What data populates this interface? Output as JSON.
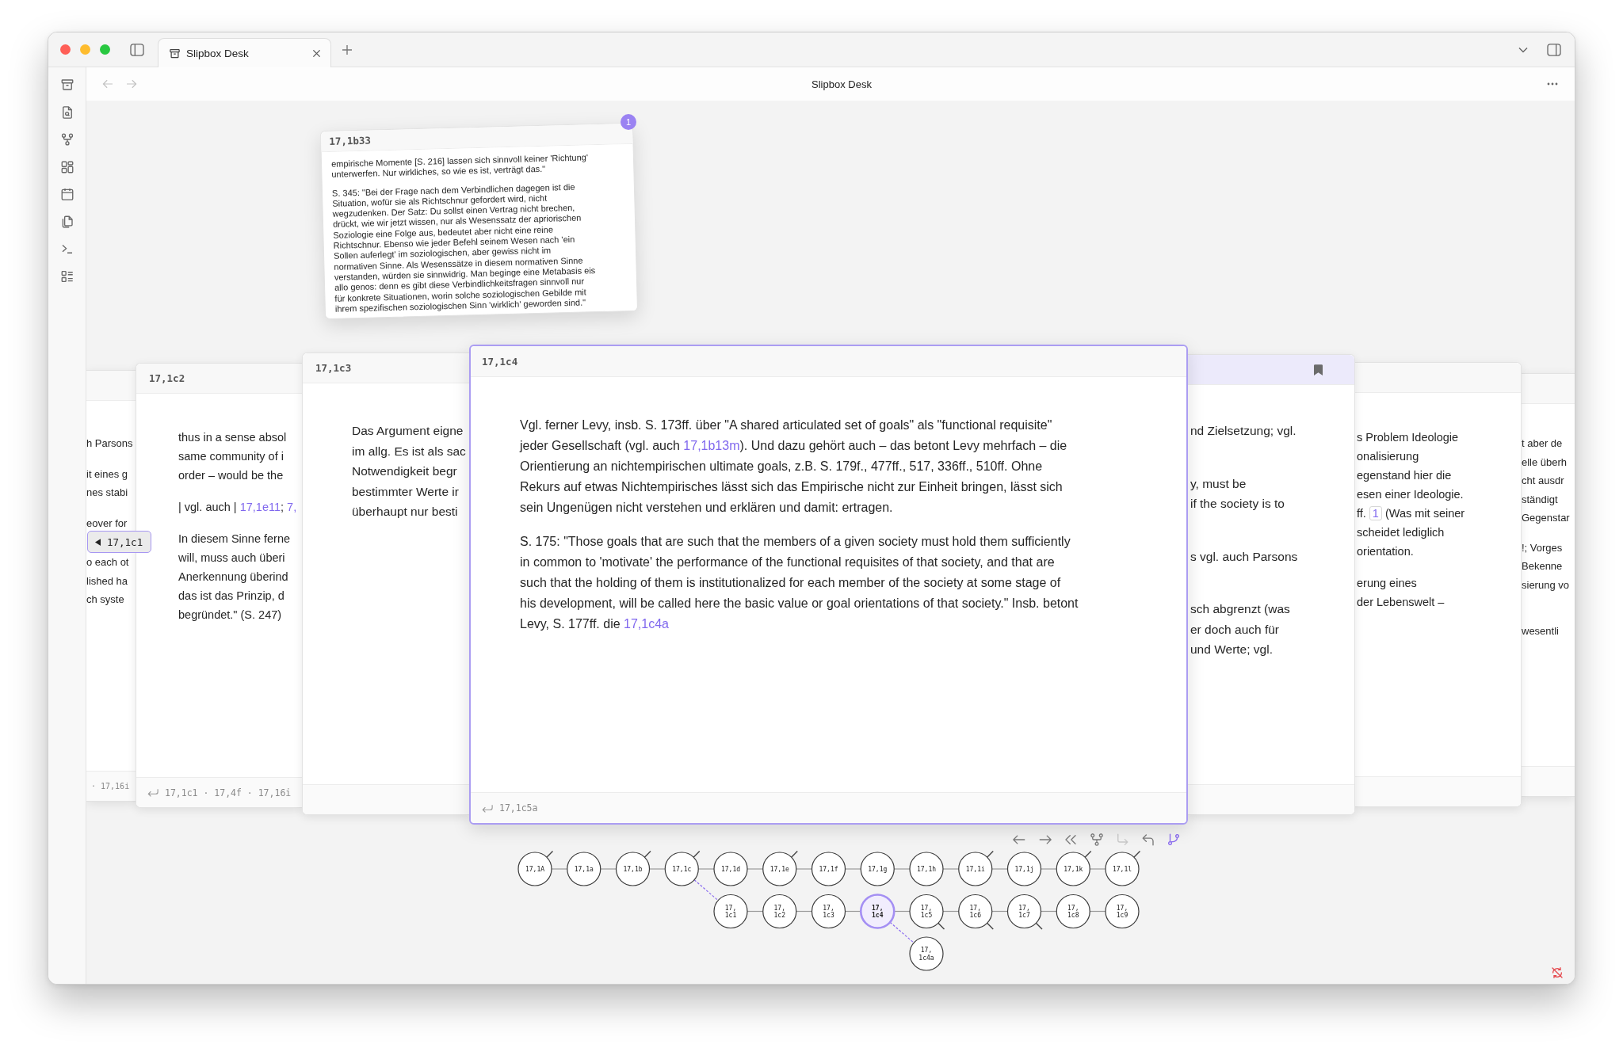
{
  "tabs": [
    {
      "title": "Slipbox Desk",
      "selected": true
    }
  ],
  "header": {
    "title": "Slipbox Desk",
    "back_disabled": true,
    "forward_disabled": true
  },
  "floating_card": {
    "id": "17,1b33",
    "badge": "1",
    "paragraphs": [
      {
        "lines": [
          [
            {
              "kind": "text",
              "text": "empirische Momente [S. 216] lassen sich sinnvoll keiner 'Richtung'"
            }
          ],
          [
            {
              "kind": "text",
              "text": "unterwerfen. Nur wirkliches, so wie es ist, verträgt das.\""
            }
          ]
        ]
      },
      {
        "lines": [
          [
            {
              "kind": "text",
              "text": "S. 345: \"Bei der Frage nach dem Verbindlichen dagegen ist die"
            }
          ],
          [
            {
              "kind": "text",
              "text": "Situation, wofür sie als Richtschnur gefordert wird, nicht"
            }
          ],
          [
            {
              "kind": "text",
              "text": "wegzudenken. Der Satz: Du sollst einen Vertrag nicht brechen,"
            }
          ],
          [
            {
              "kind": "text",
              "text": "drückt, wie wir jetzt wissen, nur als Wesenssatz der apriorischen"
            }
          ],
          [
            {
              "kind": "text",
              "text": "Soziologie eine Folge aus, bedeutet aber nicht eine reine"
            }
          ],
          [
            {
              "kind": "text",
              "text": "Richtschnur. Ebenso wie jeder Befehl seinem Wesen nach 'ein"
            }
          ],
          [
            {
              "kind": "text",
              "text": "Sollen auferlegt' im soziologischen, aber gewiss nicht im"
            }
          ],
          [
            {
              "kind": "text",
              "text": "normativen Sinne. Als Wesenssätze in diesem normativen Sinne"
            }
          ],
          [
            {
              "kind": "text",
              "text": "verstanden, würden sie sinnwidrig. Man beginge eine Metabasis eis"
            }
          ],
          [
            {
              "kind": "text",
              "text": "allo genos: denn es gibt diese Verbindlichkeitsfragen sinnvoll nur"
            }
          ],
          [
            {
              "kind": "text",
              "text": "für konkrete Situationen, worin solche soziologischen Gebilde mit"
            }
          ],
          [
            {
              "kind": "text",
              "text": "ihrem spezifischen soziologischen Sinn 'wirklich' geworden sind.\""
            }
          ]
        ]
      }
    ]
  },
  "cards": [
    {
      "bookmarked": false,
      "selected": false,
      "paragraphs": [
        {
          "lines": [
            [
              {
                "kind": "text",
                "text": "h Parsons"
              }
            ]
          ]
        },
        {
          "lines": [
            [
              {
                "kind": "text",
                "text": "it eines g"
              }
            ],
            [
              {
                "kind": "text",
                "text": "nes stabi"
              }
            ]
          ]
        },
        {
          "lines": [
            [
              {
                "kind": "text",
                "text": "eover for"
              }
            ]
          ]
        },
        {
          "lines": [
            [
              {
                "kind": "text",
                "text": "o each ot"
              }
            ],
            [
              {
                "kind": "text",
                "text": "lished ha"
              }
            ],
            [
              {
                "kind": "text",
                "text": "ch syste"
              }
            ]
          ]
        }
      ],
      "footer": "· 17,16i"
    },
    {
      "id": "17,1c2",
      "bookmarked": false,
      "selected": false,
      "paragraphs": [
        {
          "lines": [
            [
              {
                "kind": "text",
                "text": "thus in a sense absol"
              }
            ],
            [
              {
                "kind": "text",
                "text": "same community of i"
              }
            ],
            [
              {
                "kind": "text",
                "text": "order – would be the"
              }
            ]
          ]
        },
        {
          "lines": [
            [
              {
                "kind": "text",
                "text": "| vgl. auch | "
              },
              {
                "kind": "link",
                "text": "17,1e11"
              },
              {
                "kind": "text",
                "text": "; "
              },
              {
                "kind": "link",
                "text": "7,"
              }
            ]
          ]
        },
        {
          "lines": [
            [
              {
                "kind": "text",
                "text": "In diesem Sinne ferne"
              }
            ],
            [
              {
                "kind": "text",
                "text": "will, muss auch überi"
              }
            ],
            [
              {
                "kind": "text",
                "text": "Anerkennung überind"
              }
            ],
            [
              {
                "kind": "text",
                "text": "das ist das Prinzip, d"
              }
            ],
            [
              {
                "kind": "text",
                "text": "begründet.\" (S. 247)"
              }
            ]
          ]
        }
      ],
      "footer": "17,1c1 · 17,4f · 17,16i"
    },
    {
      "id": "17,1c3",
      "bookmarked": false,
      "selected": false,
      "paragraphs": [
        {
          "lines": [
            [
              {
                "kind": "text",
                "text": "Das Argument eigne"
              }
            ],
            [
              {
                "kind": "text",
                "text": "im allg. Es ist als sac"
              }
            ],
            [
              {
                "kind": "text",
                "text": "Notwendigkeit begr"
              }
            ],
            [
              {
                "kind": "text",
                "text": "bestimmter Werte ir"
              }
            ],
            [
              {
                "kind": "text",
                "text": "überhaupt nur besti"
              }
            ]
          ]
        }
      ]
    },
    {
      "id": "17,1c4",
      "bookmarked": false,
      "selected": true,
      "paragraphs": [
        {
          "lines": [
            [
              {
                "kind": "text",
                "text": "Vgl. ferner Levy, insb. S. 173ff. über \"A shared articulated set of goals\" als \"functional requisite\""
              }
            ],
            [
              {
                "kind": "text",
                "text": "jeder Gesellschaft (vgl. auch "
              },
              {
                "kind": "link",
                "text": "17,1b13m"
              },
              {
                "kind": "text",
                "text": "). Und dazu gehört auch – das betont Levy mehrfach – die"
              }
            ],
            [
              {
                "kind": "text",
                "text": "Orientierung an nichtempirischen ultimate goals, z.B. S. 179f., 477ff., 517, 336ff., 510ff. Ohne"
              }
            ],
            [
              {
                "kind": "text",
                "text": "Rekurs auf etwas Nichtempirisches lässt sich das Empirische nicht zur Einheit bringen, lässt sich"
              }
            ],
            [
              {
                "kind": "text",
                "text": "sein Ungenügen nicht verstehen und erklären und damit: ertragen."
              }
            ]
          ]
        },
        {
          "lines": [
            [
              {
                "kind": "text",
                "text": "S. 175: \"Those goals that are such that the members of a given society must hold them sufficiently"
              }
            ],
            [
              {
                "kind": "text",
                "text": "in common to 'motivate' the performance of the functional requisites of that society, and that are"
              }
            ],
            [
              {
                "kind": "text",
                "text": "such that the holding of them is institutionalized for each member of the society at some stage of"
              }
            ],
            [
              {
                "kind": "text",
                "text": "his development, will be called here the basic value or goal orientations of that society.\" Insb. betont"
              }
            ],
            [
              {
                "kind": "text",
                "text": "Levy, S. 177ff. die "
              },
              {
                "kind": "link",
                "text": "17,1c4a"
              }
            ]
          ]
        }
      ],
      "footer": "17,1c5a"
    },
    {
      "bookmarked": true,
      "selected": false,
      "paragraphs": [
        {
          "lines": [
            [
              {
                "kind": "text",
                "text": "nd Zielsetzung; vgl."
              }
            ]
          ]
        },
        {
          "lines": [
            [
              {
                "kind": "text",
                "text": "y, must be"
              }
            ],
            [
              {
                "kind": "text",
                "text": "if the society is to"
              }
            ]
          ]
        },
        {
          "lines": [
            [
              {
                "kind": "text",
                "text": "s vgl. auch Parsons"
              }
            ]
          ]
        },
        {
          "lines": [
            [
              {
                "kind": "text",
                "text": "sch abgrenzt (was"
              }
            ],
            [
              {
                "kind": "text",
                "text": "er doch auch für"
              }
            ],
            [
              {
                "kind": "text",
                "text": "und Werte; vgl."
              }
            ]
          ]
        }
      ]
    },
    {
      "bookmarked": false,
      "selected": false,
      "paragraphs": [
        {
          "lines": [
            [
              {
                "kind": "text",
                "text": "s Problem Ideologie"
              }
            ],
            [
              {
                "kind": "text",
                "text": "onalisierung"
              }
            ],
            [
              {
                "kind": "text",
                "text": "egenstand hier die"
              }
            ],
            [
              {
                "kind": "text",
                "text": "esen einer Ideologie."
              }
            ],
            [
              {
                "kind": "text",
                "text": "ff. "
              },
              {
                "kind": "footnote",
                "text": "1"
              },
              {
                "kind": "text",
                "text": " (Was mit seiner"
              }
            ],
            [
              {
                "kind": "text",
                "text": "scheidet lediglich"
              }
            ],
            [
              {
                "kind": "text",
                "text": "orientation."
              }
            ]
          ]
        },
        {
          "lines": [
            [
              {
                "kind": "text",
                "text": "erung eines"
              }
            ],
            [
              {
                "kind": "text",
                "text": "der Lebenswelt –"
              }
            ]
          ]
        }
      ]
    },
    {
      "bookmarked": false,
      "selected": false,
      "paragraphs": [
        {
          "lines": [
            [
              {
                "kind": "text",
                "text": "t aber de"
              }
            ],
            [
              {
                "kind": "text",
                "text": "elle überh"
              }
            ],
            [
              {
                "kind": "text",
                "text": "cht ausdr"
              }
            ],
            [
              {
                "kind": "text",
                "text": "ständigt"
              }
            ],
            [
              {
                "kind": "text",
                "text": "Gegenstar"
              }
            ]
          ]
        },
        {
          "lines": [
            [
              {
                "kind": "text",
                "text": "!; Vorges"
              }
            ],
            [
              {
                "kind": "text",
                "text": "Bekenne"
              }
            ],
            [
              {
                "kind": "text",
                "text": "sierung vo"
              }
            ]
          ]
        },
        {
          "lines": [
            [
              {
                "kind": "text",
                "text": "wesentli"
              }
            ]
          ]
        }
      ]
    }
  ],
  "backlink_tag": {
    "label": "17,1c1"
  },
  "graph_toolbar": [
    {
      "disabled": false,
      "selected": false
    },
    {
      "disabled": false,
      "selected": false
    },
    {
      "disabled": false,
      "selected": false
    },
    {
      "disabled": false,
      "selected": false
    },
    {
      "disabled": true,
      "selected": false
    },
    {
      "disabled": false,
      "selected": false
    },
    {
      "disabled": false,
      "selected": true
    }
  ],
  "graph": {
    "nodes": [
      {
        "label": [
          "17,1A"
        ],
        "selected": false,
        "stub_up": true,
        "stub_down": false
      },
      {
        "label": [
          "17,1a"
        ],
        "selected": false,
        "stub_up": false,
        "stub_down": false
      },
      {
        "label": [
          "17,1b"
        ],
        "selected": false,
        "stub_up": true,
        "stub_down": false
      },
      {
        "label": [
          "17,1c"
        ],
        "selected": false,
        "stub_up": true,
        "stub_down": false,
        "children": [
          {
            "label": [
              "17,",
              "1c1"
            ],
            "selected": false,
            "stub_up": false,
            "stub_down": false
          },
          {
            "label": [
              "17,",
              "1c2"
            ],
            "selected": false,
            "stub_up": false,
            "stub_down": false
          },
          {
            "label": [
              "17,",
              "1c3"
            ],
            "selected": false,
            "stub_up": false,
            "stub_down": false
          },
          {
            "label": [
              "17,",
              "1c4"
            ],
            "selected": true,
            "stub_up": false,
            "stub_down": false,
            "children": [
              {
                "label": [
                  "17,",
                  "1c4a"
                ],
                "selected": false,
                "stub_up": false,
                "stub_down": false
              }
            ]
          },
          {
            "label": [
              "17,",
              "1c5"
            ],
            "selected": false,
            "stub_up": false,
            "stub_down": true
          },
          {
            "label": [
              "17,",
              "1c6"
            ],
            "selected": false,
            "stub_up": false,
            "stub_down": true
          },
          {
            "label": [
              "17,",
              "1c7"
            ],
            "selected": false,
            "stub_up": false,
            "stub_down": true
          },
          {
            "label": [
              "17,",
              "1c8"
            ],
            "selected": false,
            "stub_up": false,
            "stub_down": false
          },
          {
            "label": [
              "17,",
              "1c9"
            ],
            "selected": false,
            "stub_up": false,
            "stub_down": false
          }
        ]
      },
      {
        "label": [
          "17,1d"
        ],
        "selected": false,
        "stub_up": false,
        "stub_down": false
      },
      {
        "label": [
          "17,1e"
        ],
        "selected": false,
        "stub_up": true,
        "stub_down": false
      },
      {
        "label": [
          "17,1f"
        ],
        "selected": false,
        "stub_up": false,
        "stub_down": false
      },
      {
        "label": [
          "17,1g"
        ],
        "selected": false,
        "stub_up": false,
        "stub_down": false
      },
      {
        "label": [
          "17,1h"
        ],
        "selected": false,
        "stub_up": false,
        "stub_down": false
      },
      {
        "label": [
          "17,1i"
        ],
        "selected": false,
        "stub_up": true,
        "stub_down": false
      },
      {
        "label": [
          "17,1j"
        ],
        "selected": false,
        "stub_up": false,
        "stub_down": false
      },
      {
        "label": [
          "17,1k"
        ],
        "selected": false,
        "stub_up": true,
        "stub_down": false
      },
      {
        "label": [
          "17,1l"
        ],
        "selected": false,
        "stub_up": true,
        "stub_down": false
      }
    ]
  }
}
